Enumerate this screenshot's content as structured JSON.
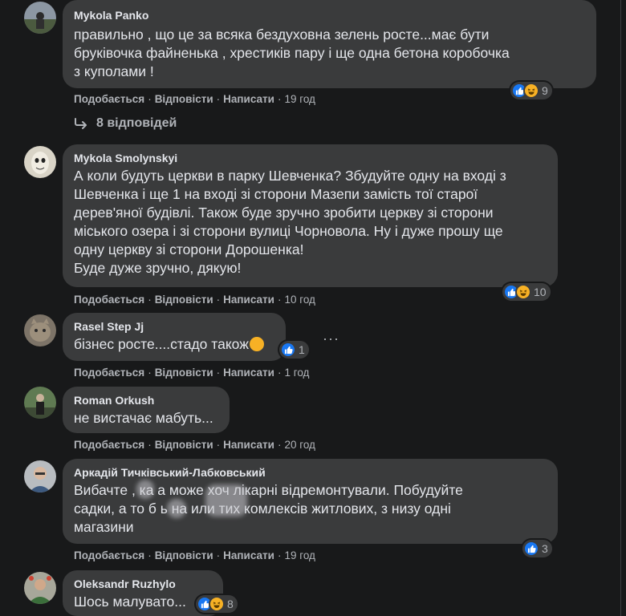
{
  "comments": [
    {
      "author": "Mykola Panko",
      "text": "правильно , що це за всяка бездуховна зелень росте...має бути\nбруківочка файненька , хрестиків пару і ще одна бетона коробочка\nз куполами !",
      "like": "Подобається",
      "reply": "Відповісти",
      "write": "Написати",
      "time": "19 год",
      "reactions": "9",
      "reaction_icons": [
        "like-icon",
        "haha-icon"
      ]
    },
    {
      "author": "Mykola Smolynskyi",
      "text": "А коли будуть церкви в парку Шевченка? Збудуйте одну на вході з\nШевченка і ще 1 на вході зі сторони Мазепи замість тої старої\nдерев'яної будівлі. Також буде зручно зробити церкву зі сторони\nміського озера і зі сторони вулиці Чорновола. Ну і дуже прошу ще\nодну церкву зі сторони Дорошенка!\nБуде дуже зручно, дякую!",
      "like": "Подобається",
      "reply": "Відповісти",
      "write": "Написати",
      "time": "10 год",
      "reactions": "10",
      "reaction_icons": [
        "like-icon",
        "haha-icon"
      ]
    },
    {
      "author": "Rasel Step Jj",
      "text": "бізнес росте....стадо також",
      "like": "Подобається",
      "reply": "Відповісти",
      "write": "Написати",
      "time": "1 год",
      "reactions": "1",
      "reaction_icons": [
        "like-icon"
      ]
    },
    {
      "author": "Roman Orkush",
      "text": "не вистачає мабуть...",
      "like": "Подобається",
      "reply": "Відповісти",
      "write": "Написати",
      "time": "20 год"
    },
    {
      "author": "Аркадій Тичківський-Лабковський",
      "text": "Вибачте ,   ка а може хоч лікарні відремонтували. Побудуйте\nсадки, а то б    ь на        или тих комлексів житлових, з низу одні\nмагазини",
      "like": "Подобається",
      "reply": "Відповісти",
      "write": "Написати",
      "time": "19 год",
      "reactions": "3",
      "reaction_icons": [
        "like-icon"
      ]
    },
    {
      "author": "Oleksandr Ruzhylo",
      "text": "Шось малувато...",
      "reactions": "8",
      "reaction_icons": [
        "like-icon",
        "haha-icon"
      ]
    }
  ],
  "replies_link": "8 відповідей",
  "more_options": "···",
  "colors": {
    "background": "#18191a",
    "bubble": "#3a3b3c",
    "text": "#e4e6eb",
    "muted": "#b0b3b8",
    "like_blue": "#1877f2",
    "haha_yellow": "#f7b125"
  }
}
